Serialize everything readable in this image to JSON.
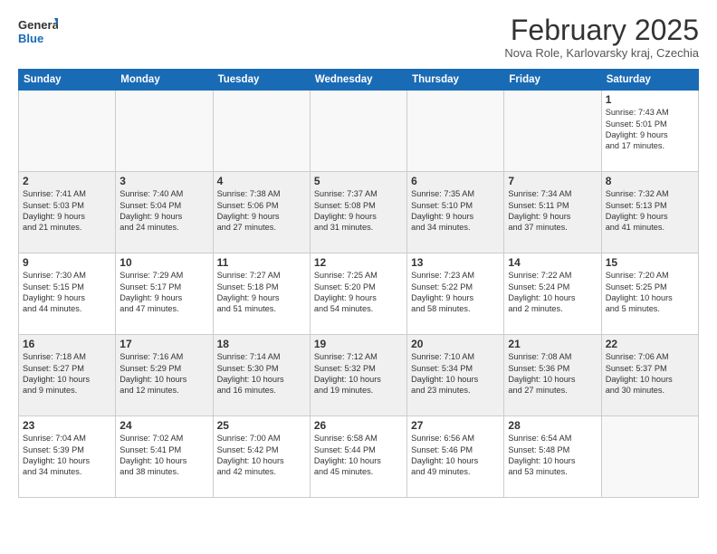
{
  "header": {
    "logo_general": "General",
    "logo_blue": "Blue",
    "month_title": "February 2025",
    "subtitle": "Nova Role, Karlovarsky kraj, Czechia"
  },
  "days_of_week": [
    "Sunday",
    "Monday",
    "Tuesday",
    "Wednesday",
    "Thursday",
    "Friday",
    "Saturday"
  ],
  "weeks": [
    {
      "shaded": false,
      "days": [
        {
          "num": "",
          "info": ""
        },
        {
          "num": "",
          "info": ""
        },
        {
          "num": "",
          "info": ""
        },
        {
          "num": "",
          "info": ""
        },
        {
          "num": "",
          "info": ""
        },
        {
          "num": "",
          "info": ""
        },
        {
          "num": "1",
          "info": "Sunrise: 7:43 AM\nSunset: 5:01 PM\nDaylight: 9 hours\nand 17 minutes."
        }
      ]
    },
    {
      "shaded": true,
      "days": [
        {
          "num": "2",
          "info": "Sunrise: 7:41 AM\nSunset: 5:03 PM\nDaylight: 9 hours\nand 21 minutes."
        },
        {
          "num": "3",
          "info": "Sunrise: 7:40 AM\nSunset: 5:04 PM\nDaylight: 9 hours\nand 24 minutes."
        },
        {
          "num": "4",
          "info": "Sunrise: 7:38 AM\nSunset: 5:06 PM\nDaylight: 9 hours\nand 27 minutes."
        },
        {
          "num": "5",
          "info": "Sunrise: 7:37 AM\nSunset: 5:08 PM\nDaylight: 9 hours\nand 31 minutes."
        },
        {
          "num": "6",
          "info": "Sunrise: 7:35 AM\nSunset: 5:10 PM\nDaylight: 9 hours\nand 34 minutes."
        },
        {
          "num": "7",
          "info": "Sunrise: 7:34 AM\nSunset: 5:11 PM\nDaylight: 9 hours\nand 37 minutes."
        },
        {
          "num": "8",
          "info": "Sunrise: 7:32 AM\nSunset: 5:13 PM\nDaylight: 9 hours\nand 41 minutes."
        }
      ]
    },
    {
      "shaded": false,
      "days": [
        {
          "num": "9",
          "info": "Sunrise: 7:30 AM\nSunset: 5:15 PM\nDaylight: 9 hours\nand 44 minutes."
        },
        {
          "num": "10",
          "info": "Sunrise: 7:29 AM\nSunset: 5:17 PM\nDaylight: 9 hours\nand 47 minutes."
        },
        {
          "num": "11",
          "info": "Sunrise: 7:27 AM\nSunset: 5:18 PM\nDaylight: 9 hours\nand 51 minutes."
        },
        {
          "num": "12",
          "info": "Sunrise: 7:25 AM\nSunset: 5:20 PM\nDaylight: 9 hours\nand 54 minutes."
        },
        {
          "num": "13",
          "info": "Sunrise: 7:23 AM\nSunset: 5:22 PM\nDaylight: 9 hours\nand 58 minutes."
        },
        {
          "num": "14",
          "info": "Sunrise: 7:22 AM\nSunset: 5:24 PM\nDaylight: 10 hours\nand 2 minutes."
        },
        {
          "num": "15",
          "info": "Sunrise: 7:20 AM\nSunset: 5:25 PM\nDaylight: 10 hours\nand 5 minutes."
        }
      ]
    },
    {
      "shaded": true,
      "days": [
        {
          "num": "16",
          "info": "Sunrise: 7:18 AM\nSunset: 5:27 PM\nDaylight: 10 hours\nand 9 minutes."
        },
        {
          "num": "17",
          "info": "Sunrise: 7:16 AM\nSunset: 5:29 PM\nDaylight: 10 hours\nand 12 minutes."
        },
        {
          "num": "18",
          "info": "Sunrise: 7:14 AM\nSunset: 5:30 PM\nDaylight: 10 hours\nand 16 minutes."
        },
        {
          "num": "19",
          "info": "Sunrise: 7:12 AM\nSunset: 5:32 PM\nDaylight: 10 hours\nand 19 minutes."
        },
        {
          "num": "20",
          "info": "Sunrise: 7:10 AM\nSunset: 5:34 PM\nDaylight: 10 hours\nand 23 minutes."
        },
        {
          "num": "21",
          "info": "Sunrise: 7:08 AM\nSunset: 5:36 PM\nDaylight: 10 hours\nand 27 minutes."
        },
        {
          "num": "22",
          "info": "Sunrise: 7:06 AM\nSunset: 5:37 PM\nDaylight: 10 hours\nand 30 minutes."
        }
      ]
    },
    {
      "shaded": false,
      "days": [
        {
          "num": "23",
          "info": "Sunrise: 7:04 AM\nSunset: 5:39 PM\nDaylight: 10 hours\nand 34 minutes."
        },
        {
          "num": "24",
          "info": "Sunrise: 7:02 AM\nSunset: 5:41 PM\nDaylight: 10 hours\nand 38 minutes."
        },
        {
          "num": "25",
          "info": "Sunrise: 7:00 AM\nSunset: 5:42 PM\nDaylight: 10 hours\nand 42 minutes."
        },
        {
          "num": "26",
          "info": "Sunrise: 6:58 AM\nSunset: 5:44 PM\nDaylight: 10 hours\nand 45 minutes."
        },
        {
          "num": "27",
          "info": "Sunrise: 6:56 AM\nSunset: 5:46 PM\nDaylight: 10 hours\nand 49 minutes."
        },
        {
          "num": "28",
          "info": "Sunrise: 6:54 AM\nSunset: 5:48 PM\nDaylight: 10 hours\nand 53 minutes."
        },
        {
          "num": "",
          "info": ""
        }
      ]
    }
  ]
}
